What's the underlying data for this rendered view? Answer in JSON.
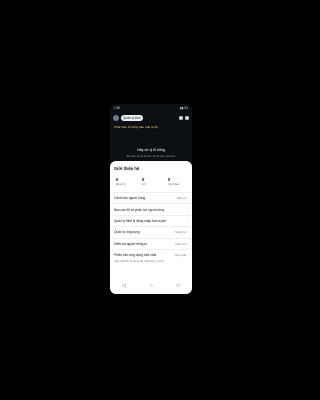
{
  "status": {
    "time": "1:50",
    "right": "▮▮ 51"
  },
  "header": {
    "pill": "Quản lý Đơn"
  },
  "vulnerability_text": "Phát hiện lỗ hổng bảo mật (2 lỗ)",
  "hero": {
    "line1": "· · ·",
    "line2": "Hãy xử lý lỗ hổng",
    "line3": "Để bảo vệ tài khoản và dữ liệu của bạn"
  },
  "sheet": {
    "title": "Giới thiệu hệ",
    "stats": [
      {
        "num": "0",
        "label": "Đã xử lý"
      },
      {
        "num": "0",
        "label": "Lỗi"
      },
      {
        "num": "0",
        "label": "Cảnh báo"
      }
    ],
    "rows": [
      {
        "label": "Cảnh báo người dùng",
        "value": "Bảo vệ"
      },
      {
        "label": "Báo cáo lỗi và phản hồi người dùng",
        "value": ""
      },
      {
        "label": "Quản lý thiết bị đăng nhập trực tuyến",
        "value": ""
      },
      {
        "label": "Quản lý ứng dụng",
        "value": "Thông tin"
      },
      {
        "label": "Kiểm tra quyền riêng tư",
        "value": "Kiểm tra"
      },
      {
        "label": "Phiên bản ứng dụng mới nhất",
        "value": "Cập nhật"
      }
    ],
    "desc": "Cập nhật để sử dụng tốt nhất (Gợi ý mới)"
  },
  "nav": {
    "back": "◁",
    "home": "○",
    "recent": "□"
  }
}
